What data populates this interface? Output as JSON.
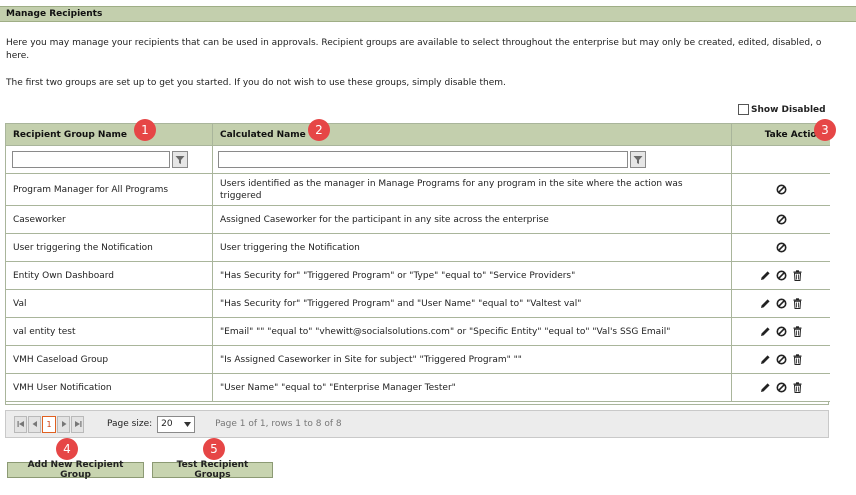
{
  "header": {
    "title": "Manage Recipients"
  },
  "intro": {
    "line1": "Here you may manage your recipients that can be used in approvals. Recipient groups are available to select throughout the enterprise but may only be created, edited, disabled, o",
    "line1b": "here.",
    "line2": "The first two groups are set up to get you started. If you do not wish to use these groups, simply disable them."
  },
  "show_disabled": {
    "label": "Show Disabled",
    "checked": false
  },
  "columns": {
    "name": "Recipient Group Name",
    "calculated": "Calculated Name",
    "action": "Take Action"
  },
  "filters": {
    "name_value": "",
    "calculated_value": ""
  },
  "rows": [
    {
      "name": "Program Manager for All Programs",
      "calculated": "Users identified as the manager in Manage Programs for any program in the site where the action was triggered",
      "editable": false
    },
    {
      "name": "Caseworker",
      "calculated": "Assigned Caseworker for the participant in any site across the enterprise",
      "editable": false
    },
    {
      "name": "User triggering the Notification",
      "calculated": "User triggering the Notification",
      "editable": false
    },
    {
      "name": "Entity Own Dashboard",
      "calculated": "\"Has Security for\" \"Triggered Program\" or \"Type\" \"equal to\" \"Service Providers\"",
      "editable": true
    },
    {
      "name": "Val",
      "calculated": "\"Has Security for\" \"Triggered Program\" and \"User Name\" \"equal to\" \"Valtest val\"",
      "editable": true
    },
    {
      "name": "val entity test",
      "calculated": "\"Email\" \"\" \"equal to\" \"vhewitt@socialsolutions.com\" or \"Specific Entity\" \"equal to\" \"Val's SSG Email\"",
      "editable": true
    },
    {
      "name": "VMH Caseload Group",
      "calculated": "\"Is Assigned Caseworker in Site for subject\" \"Triggered Program\" \"\"",
      "editable": true
    },
    {
      "name": "VMH User Notification",
      "calculated": "\"User Name\" \"equal to\" \"Enterprise Manager Tester\"",
      "editable": true
    }
  ],
  "pager": {
    "current_page": "1",
    "page_size_label": "Page size:",
    "page_size_value": "20",
    "info": "Page 1 of 1, rows 1 to 8 of 8"
  },
  "buttons": {
    "add": "Add New Recipient Group",
    "test": "Test Recipient Groups"
  },
  "badges": [
    "1",
    "2",
    "3",
    "4",
    "5"
  ],
  "colors": {
    "header_bg": "#c3cfad",
    "badge": "#e64646",
    "button_bg": "#c8d4b0"
  }
}
